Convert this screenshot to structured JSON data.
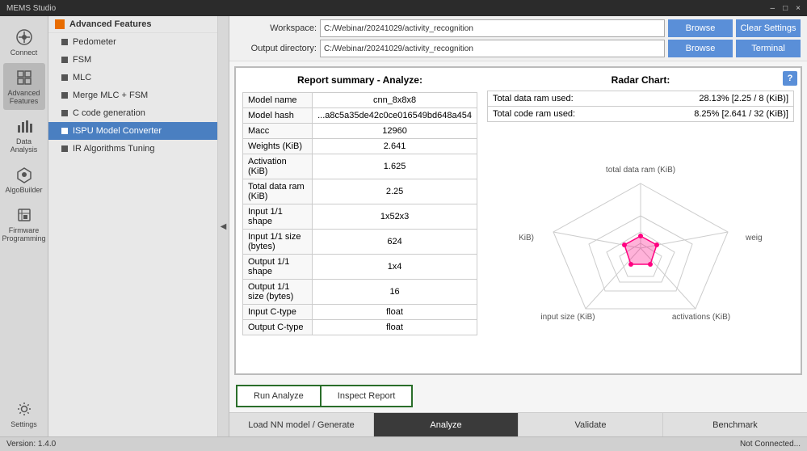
{
  "topBar": {
    "title": "MEMS Studio",
    "controls": [
      "–",
      "□",
      "×"
    ]
  },
  "sidebar": {
    "header": "Advanced Features",
    "items": [
      {
        "label": "Pedometer",
        "active": false
      },
      {
        "label": "FSM",
        "active": false
      },
      {
        "label": "MLC",
        "active": false
      },
      {
        "label": "Merge MLC + FSM",
        "active": false
      },
      {
        "label": "C code generation",
        "active": false
      },
      {
        "label": "ISPU Model Converter",
        "active": true
      },
      {
        "label": "IR Algorithms Tuning",
        "active": false
      }
    ]
  },
  "navIcons": [
    {
      "label": "Connect",
      "icon": "🔌"
    },
    {
      "label": "Advanced Features",
      "icon": "⚙",
      "active": true
    },
    {
      "label": "Data Analysis",
      "icon": "📊"
    },
    {
      "label": "AlgoBuilder",
      "icon": "🔧"
    },
    {
      "label": "Firmware Programming",
      "icon": "💾"
    },
    {
      "label": "Settings",
      "icon": "⚙"
    }
  ],
  "workspace": {
    "label": "Workspace:",
    "value": "C:/Webinar/20241029/activity_recognition",
    "browseLabel": "Browse",
    "clearLabel": "Clear Settings",
    "outputLabel": "Output directory:",
    "outputValue": "C:/Webinar/20241029/activity_recognition",
    "browse2Label": "Browse",
    "terminalLabel": "Terminal"
  },
  "report": {
    "title": "Report summary - Analyze:",
    "helpBtn": "?",
    "table": [
      {
        "key": "Model name",
        "value": "cnn_8x8x8"
      },
      {
        "key": "Model hash",
        "value": "...a8c5a35de42c0ce016549bd648a454"
      },
      {
        "key": "Macc",
        "value": "12960"
      },
      {
        "key": "Weights (KiB)",
        "value": "2.641"
      },
      {
        "key": "Activation (KiB)",
        "value": "1.625"
      },
      {
        "key": "Total data ram (KiB)",
        "value": "2.25"
      },
      {
        "key": "Input 1/1 shape",
        "value": "1x52x3"
      },
      {
        "key": "Input 1/1 size (bytes)",
        "value": "624"
      },
      {
        "key": "Output 1/1 shape",
        "value": "1x4"
      },
      {
        "key": "Output 1/1 size (bytes)",
        "value": "16"
      },
      {
        "key": "Input C-type",
        "value": "float"
      },
      {
        "key": "Output C-type",
        "value": "float"
      }
    ]
  },
  "radar": {
    "title": "Radar Chart:",
    "stats": [
      {
        "label": "Total data ram used:",
        "value": "28.13%  [2.25 / 8 (KiB)]"
      },
      {
        "label": "Total code ram used:",
        "value": "8.25%   [2.641 / 32 (KiB)]"
      }
    ],
    "labels": [
      "total data ram (KiB)",
      "weights (KiB)",
      "activations (KiB)",
      "input size (KiB)",
      "output size (KiB)"
    ]
  },
  "bottomButtons": [
    {
      "label": "Run Analyze",
      "active": false
    },
    {
      "label": "Inspect Report",
      "active": false
    }
  ],
  "tabs": [
    {
      "label": "Load NN model / Generate",
      "active": false
    },
    {
      "label": "Analyze",
      "active": true
    },
    {
      "label": "Validate",
      "active": false
    },
    {
      "label": "Benchmark",
      "active": false
    }
  ],
  "statusBar": {
    "version": "Version: 1.4.0",
    "connection": "Not Connected..."
  }
}
